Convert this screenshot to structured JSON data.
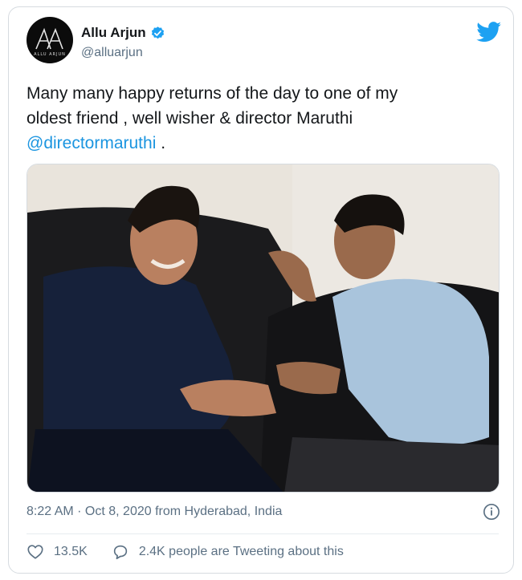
{
  "tweet": {
    "author_name": "Allu Arjun",
    "handle": "@alluarjun",
    "avatar_text": "ALLU ARJUN",
    "text_line1": "Many many happy returns of the day to one of my",
    "text_line2": "oldest friend , well wisher & director Maruthi",
    "mention": "@directormaruthi",
    "text_end": " .",
    "photo_icon": "photo-two-men-on-sofa",
    "meta": "8:22 AM · Oct 8, 2020 from Hyderabad, India",
    "likes": "13.5K",
    "conversation": "2.4K people are Tweeting about this"
  },
  "icons": {
    "verified": "verified-badge-icon",
    "bird": "twitter-bird-icon",
    "info": "info-icon",
    "heart": "heart-icon",
    "reply": "speech-bubble-icon"
  },
  "colors": {
    "brand": "#1da1f2",
    "link": "#1b95e0",
    "secondary_text": "#5b7083",
    "text": "#14171a"
  }
}
